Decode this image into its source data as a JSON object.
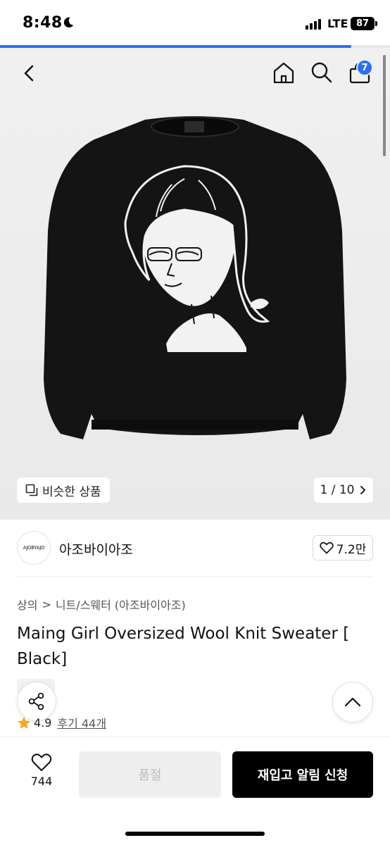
{
  "status_bar": {
    "time": "8:48",
    "network": "LTE",
    "battery": "87"
  },
  "header": {
    "cart_count": "7"
  },
  "gallery": {
    "similar_label": "비슷한 상품",
    "counter": "1 / 10",
    "progress": 0.9
  },
  "brand": {
    "logo_text": "AJOBYAJO",
    "name": "아조바이아조",
    "likes": "7.2만"
  },
  "breadcrumb": {
    "level1": "상의",
    "separator": ">",
    "level2": "니트/스웨터 (아조바이아조)"
  },
  "product": {
    "title": "Maing Girl Oversized Wool Knit Sweater [ Black]",
    "rating": "4.9",
    "reviews": "후기 44개"
  },
  "bottom_bar": {
    "wish_count": "744",
    "soldout_label": "품절",
    "restock_label": "재입고 알림 신청"
  },
  "colors": {
    "accent": "#2b6ef2",
    "primary_button": "#000000",
    "star": "#f5a623"
  },
  "icons": [
    "back-icon",
    "home-icon",
    "search-icon",
    "bag-icon",
    "similar-icon",
    "chevron-right-icon",
    "heart-icon",
    "share-icon",
    "chevron-up-icon",
    "star-icon",
    "moon-icon"
  ]
}
